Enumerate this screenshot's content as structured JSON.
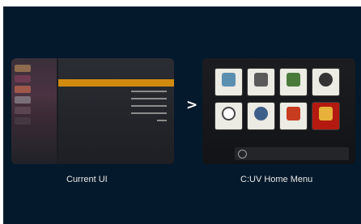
{
  "captions": {
    "left": "Current UI",
    "right": "C:UV Home Menu",
    "arrow": ">"
  },
  "current_ui": {
    "sidebar_items": [
      "",
      "",
      "",
      "",
      "",
      ""
    ],
    "header": "",
    "rows": [
      {
        "label": "",
        "value": "",
        "selected": true
      },
      {
        "label": "",
        "value": "",
        "selected": false
      },
      {
        "label": "",
        "value": "",
        "selected": false
      },
      {
        "label": "",
        "value": "",
        "selected": false
      },
      {
        "label": "",
        "value": "",
        "selected": false
      },
      {
        "label": "",
        "value": "",
        "selected": false
      }
    ],
    "accent_color": "#d08a10"
  },
  "cuv_home": {
    "tiles": [
      {
        "icon": "satellite-dish-icon",
        "label": "",
        "color": "#5b8fb0"
      },
      {
        "icon": "antenna-icon",
        "label": "",
        "color": "#5a5a5a"
      },
      {
        "icon": "picture-icon",
        "label": "",
        "color": "#4a7a3a"
      },
      {
        "icon": "headphones-icon",
        "label": "",
        "color": "#333333"
      },
      {
        "icon": "clock-icon",
        "label": "",
        "color": "#444444"
      },
      {
        "icon": "lock-icon",
        "label": "",
        "color": "#3f5f8a"
      },
      {
        "icon": "options-icon",
        "label": "",
        "color": "#c73b1e"
      },
      {
        "icon": "folder-icon",
        "label": "",
        "color": "#e8b23a"
      }
    ],
    "note": "",
    "highlight_color": "#b41a10"
  },
  "background_color": "#04192b"
}
